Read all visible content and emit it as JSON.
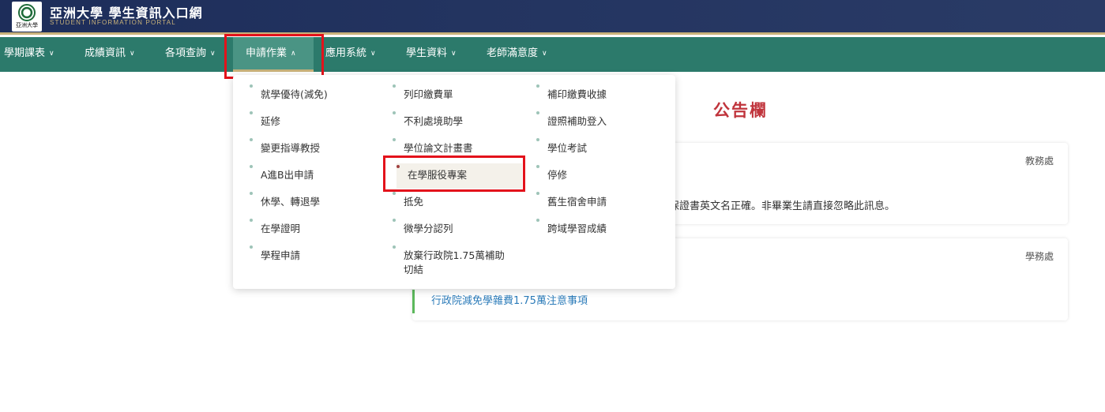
{
  "header": {
    "logo_text": "亞洲大學",
    "title": "亞洲大學 學生資訊入口網",
    "subtitle": "STUDENT INFORMATION PORTAL"
  },
  "nav": {
    "items": [
      {
        "label": "學期課表"
      },
      {
        "label": "成績資訊"
      },
      {
        "label": "各項查詢"
      },
      {
        "label": "申請作業"
      },
      {
        "label": "應用系統"
      },
      {
        "label": "學生資料"
      },
      {
        "label": "老師滿意度"
      }
    ],
    "active_index": 3
  },
  "dropdown": {
    "col1": [
      "就學優待(減免)",
      "延修",
      "變更指導教授",
      "A進B出申請",
      "休學、轉退學",
      "在學證明",
      "學程申請"
    ],
    "col2": [
      "列印繳費單",
      "不利處境助學",
      "學位論文計畫書",
      "在學服役專案",
      "抵免",
      "微學分認列",
      "放棄行政院1.75萬補助",
      "切結"
    ],
    "col3": [
      "補印繳費收據",
      "證照補助登入",
      "學位考試",
      "停修",
      "舊生宿舍申請",
      "跨域學習成績"
    ]
  },
  "board": {
    "title": "公告欄",
    "cards": [
      {
        "dept": "教務處",
        "text": "保證書英文名正確。非畢業生請直接忽略此訊息。"
      },
      {
        "dept": "學務處",
        "link": "行政院減免學雜費1.75萬注意事項"
      }
    ]
  },
  "colors": {
    "header_bg": "#1d2d5a",
    "nav_bg": "#2c7a6b",
    "accent_gold": "#c9b27a",
    "highlight_red": "#e3121b",
    "board_title": "#c0343c",
    "link": "#2b7bb9"
  }
}
